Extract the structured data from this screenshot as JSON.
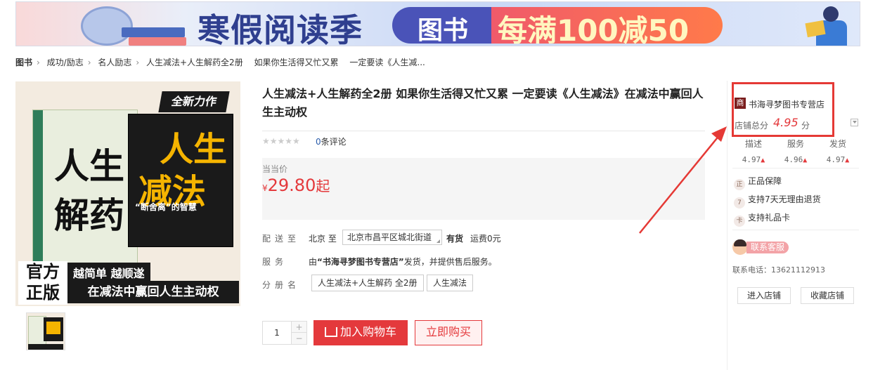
{
  "banner": {
    "title": "寒假阅读季",
    "category": "图书",
    "promo": "每满100减50"
  },
  "breadcrumb": [
    "图书",
    "成功/励志",
    "名人励志",
    "人生减法+人生解药全2册",
    "如果你生活得又忙又累",
    "一定要读《人生减..."
  ],
  "cover": {
    "new_tag": "全新力作",
    "left_title": "人生解药",
    "right_title": "人生减法",
    "right_caption": "“断舍离”的智慧",
    "badge": "官方正版",
    "slogan_top": "越简单  越顺遂",
    "slogan_bottom": "在减法中赢回人生主动权"
  },
  "product": {
    "title": "人生减法+人生解药全2册 如果你生活得又忙又累 一定要读《人生减法》在减法中赢回人生主动权",
    "stars": "★★★★★",
    "review_count": "0",
    "review_suffix": "条评论",
    "price_label": "当当价",
    "price_symbol": "¥",
    "price": "29.80",
    "price_suffix": "起",
    "delivery_label": "配送至",
    "delivery_city": "北京 至",
    "delivery_address": "北京市昌平区城北街道",
    "stock": "有货",
    "shipping_fee": "运费0元",
    "service_label": "服务",
    "service_prefix": "由",
    "service_shop": "“书海寻梦图书专营店”",
    "service_suffix": "发货，并提供售后服务。",
    "volume_label": "分册名",
    "volumes": [
      "人生减法+人生解药 全2册",
      "人生减法"
    ],
    "quantity": "1",
    "add_to_cart": "加入购物车",
    "buy_now": "立即购买",
    "plus": "+",
    "minus": "−"
  },
  "store": {
    "icon_text": "商",
    "name": "书海寻梦图书专营店",
    "score_label": "店铺总分",
    "score": "4.95",
    "score_unit": "分",
    "metrics": [
      {
        "label": "描述",
        "value": "4.97"
      },
      {
        "label": "服务",
        "value": "4.96"
      },
      {
        "label": "发货",
        "value": "4.97"
      }
    ],
    "perks": [
      {
        "icon": "正",
        "label": "正品保障"
      },
      {
        "icon": "7",
        "label": "支持7天无理由退货"
      },
      {
        "icon": "卡",
        "label": "支持礼品卡"
      }
    ],
    "contact_label": "联系客服",
    "phone": "联系电话：13621112913",
    "enter_store": "进入店铺",
    "favorite_store": "收藏店铺"
  },
  "colors": {
    "accent": "#e4393c",
    "highlight": "#e53935",
    "link": "#2a5caa"
  }
}
